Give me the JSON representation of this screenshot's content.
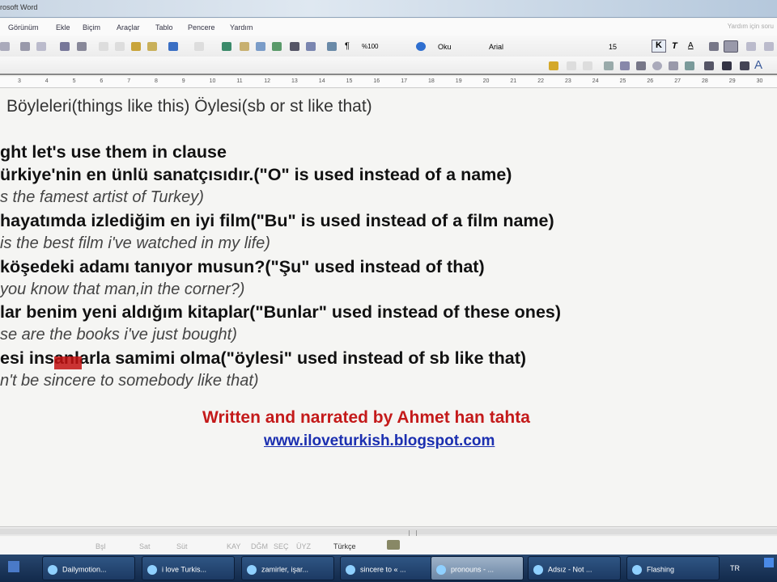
{
  "window": {
    "title": "rosoft Word",
    "help_box": "Yardım için soru"
  },
  "menu": [
    "Görünüm",
    "Ekle",
    "Biçim",
    "Araçlar",
    "Tablo",
    "Pencere",
    "Yardım"
  ],
  "toolbar": {
    "zoom": "%100",
    "read": "Oku",
    "font": "Arial",
    "size": "15",
    "bold": "K",
    "italic": "T",
    "underline": "A"
  },
  "ruler": [
    "3",
    "4",
    "5",
    "6",
    "7",
    "8",
    "9",
    "10",
    "11",
    "12",
    "13",
    "14",
    "15",
    "16",
    "17",
    "18",
    "19",
    "20",
    "21",
    "22",
    "23",
    "24",
    "25",
    "26",
    "27",
    "28",
    "29",
    "30"
  ],
  "document": {
    "lines": [
      "Böyleleri(things like this) Öylesi(sb or st like that)",
      "ght let's use them in clause",
      "ürkiye'nin en ünlü sanatçısıdır.(\"O\" is used instead of a name)",
      "s the famest artist of Turkey)",
      "hayatımda izlediğim en iyi film(\"Bu\" is used instead of a film name)",
      " is the best film i've watched in my life)",
      "köşedeki adamı tanıyor musun?(\"Şu\" used instead of that)",
      "you know that man,in the corner?)",
      "lar benim yeni aldığım kitaplar(\"Bunlar\" used instead of these ones)",
      "se are the books i've just bought)",
      "esi insanlarla samimi olma(\"öylesi\" used instead of sb like that)",
      "n't be sincere to somebody like that)"
    ],
    "credit": "Written and narrated by Ahmet han tahta",
    "link": "www.iloveturkish.blogspot.com"
  },
  "status": {
    "items": [
      "Bşl",
      "Sat",
      "Süt",
      "KAY",
      "DĞM",
      "SEÇ",
      "ÜYZ"
    ],
    "language": "Türkçe"
  },
  "taskbar": {
    "tasks": [
      "Dailymotion...",
      "i love Turkis...",
      "zamirler, işar...",
      "sincere to « ...",
      "pronouns - ...",
      "Adsız - Not ...",
      "Flashing"
    ],
    "active_index": 4,
    "lang": "TR"
  },
  "colors": {
    "credit": "#c41a1a",
    "link": "#1b2fb0",
    "taskbar": "#1c3a63"
  }
}
